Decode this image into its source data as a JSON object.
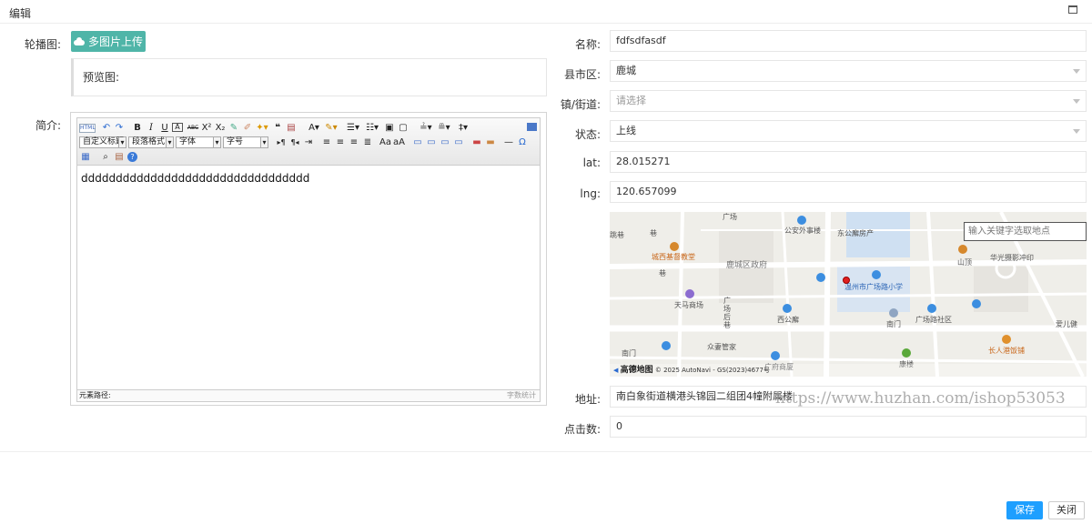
{
  "dialog": {
    "title": "编辑"
  },
  "left": {
    "carousel_label": "轮播图:",
    "upload_button": "多图片上传",
    "preview_label": "预览图:",
    "intro_label": "简介:",
    "editor": {
      "html_btn": "HTML",
      "custom_title": "自定义标题",
      "paragraph_format": "段落格式",
      "font_family": "字体",
      "font_size": "字号",
      "content": "ddddddddddddddddddddddddddddddddd",
      "path_label": "元素路径:",
      "word_count_label": "字数统计"
    }
  },
  "right": {
    "name": {
      "label": "名称:",
      "value": "fdfsdfasdf"
    },
    "county": {
      "label": "县市区:",
      "value": "鹿城"
    },
    "town": {
      "label": "镇/街道:",
      "placeholder": "请选择"
    },
    "status": {
      "label": "状态:",
      "value": "上线"
    },
    "lat": {
      "label": "lat:",
      "value": "28.015271"
    },
    "lng": {
      "label": "lng:",
      "value": "120.657099"
    },
    "map": {
      "search_placeholder": "输入关键字选取地点",
      "pois": {
        "p1": "公安外事楼",
        "p2": "东公廨房产",
        "p3": "城西基督教堂",
        "p4": "鹿城区政府",
        "p5": "温州市广场路小学",
        "p6": "华光摄影冲印",
        "p7": "山顶",
        "p8": "天马商场",
        "p9": "西公廨",
        "p10": "南门",
        "p11": "广场路社区",
        "p12": "众妻管家",
        "p13": "广府商厦",
        "p14": "康楼",
        "p15": "长人港饭铺",
        "p16": "爱儿健",
        "p17": "跳巷",
        "p18": "广场后巷",
        "p19": "南门",
        "p20": "巷",
        "p21": "广场",
        "p22": "巷"
      },
      "brand": "高德地图",
      "copyright": "© 2025 AutoNavi - GS(2023)4677号"
    },
    "address": {
      "label": "地址:",
      "value": "南白象街道横港头锦园二组团4幢附属楼"
    },
    "clicks": {
      "label": "点击数:",
      "value": "0"
    }
  },
  "watermark": "https://www.huzhan.com/ishop53053",
  "footer": {
    "save": "保存",
    "close": "关闭"
  }
}
